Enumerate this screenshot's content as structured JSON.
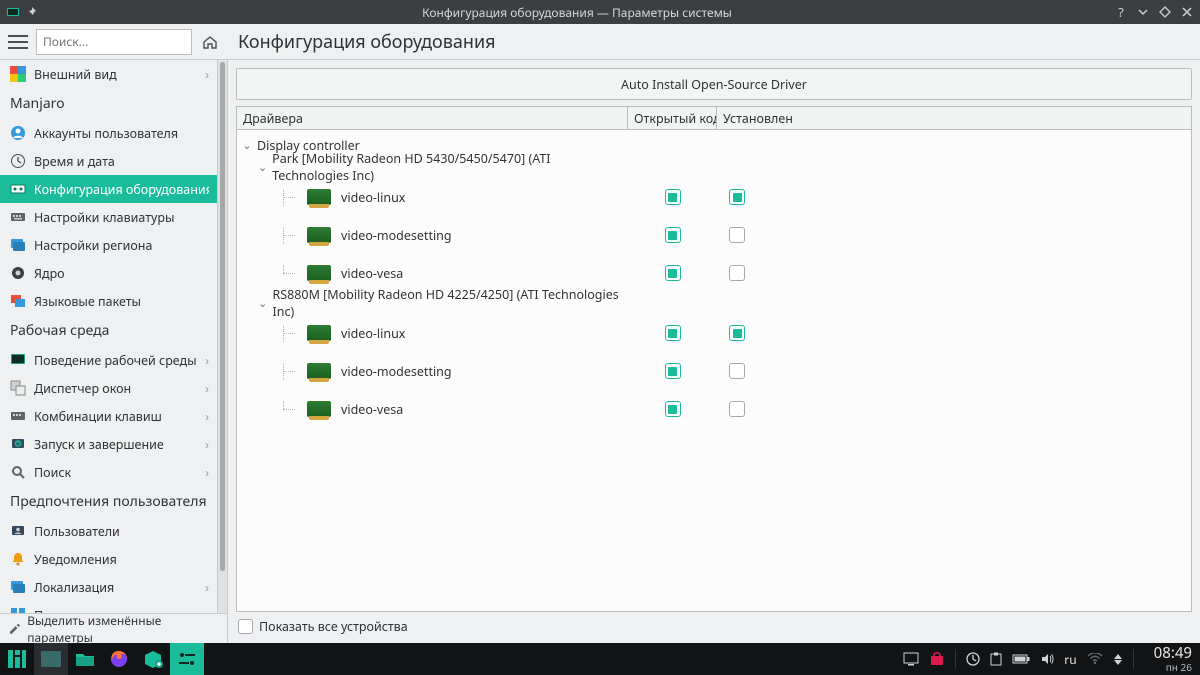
{
  "window": {
    "title": "Конфигурация оборудования — Параметры системы"
  },
  "toolbar": {
    "search_placeholder": "Поиск...",
    "page_title": "Конфигурация оборудования"
  },
  "sidebar": {
    "groups": [
      {
        "head": null,
        "items": [
          {
            "icon": "appearance",
            "label": "Внешний вид",
            "chev": true
          }
        ]
      },
      {
        "head": "Manjaro",
        "items": [
          {
            "icon": "accounts",
            "label": "Аккаунты пользователя"
          },
          {
            "icon": "clock",
            "label": "Время и дата"
          },
          {
            "icon": "hardware",
            "label": "Конфигурация оборудования",
            "active": true
          },
          {
            "icon": "keyboard",
            "label": "Настройки клавиатуры"
          },
          {
            "icon": "locale",
            "label": "Настройки региона"
          },
          {
            "icon": "kernel",
            "label": "Ядро"
          },
          {
            "icon": "lang",
            "label": "Языковые пакеты"
          }
        ]
      },
      {
        "head": "Рабочая среда",
        "items": [
          {
            "icon": "desktop-behavior",
            "label": "Поведение рабочей среды",
            "chev": true
          },
          {
            "icon": "wm",
            "label": "Диспетчер окон",
            "chev": true
          },
          {
            "icon": "shortcuts",
            "label": "Комбинации клавиш",
            "chev": true
          },
          {
            "icon": "startup",
            "label": "Запуск и завершение",
            "chev": true
          },
          {
            "icon": "search",
            "label": "Поиск",
            "chev": true
          }
        ]
      },
      {
        "head": "Предпочтения пользователя",
        "items": [
          {
            "icon": "users",
            "label": "Пользователи"
          },
          {
            "icon": "notify",
            "label": "Уведомления"
          },
          {
            "icon": "locale2",
            "label": "Локализация",
            "chev": true
          },
          {
            "icon": "apps",
            "label": "Приложения",
            "chev": true
          }
        ]
      }
    ],
    "footer": "Выделить изменённые параметры"
  },
  "main": {
    "auto_button": "Auto Install Open-Source Driver",
    "columns": {
      "c1": "Драйвера",
      "c2": "Открытый код",
      "c3": "Установлен"
    },
    "tree_root": "Display controller",
    "devices": [
      {
        "name": "Park [Mobility Radeon HD 5430/5450/5470] (ATI Technologies Inc)",
        "drivers": [
          {
            "name": "video-linux",
            "open": true,
            "installed": true
          },
          {
            "name": "video-modesetting",
            "open": true,
            "installed": false
          },
          {
            "name": "video-vesa",
            "open": true,
            "installed": false
          }
        ]
      },
      {
        "name": "RS880M [Mobility Radeon HD 4225/4250] (ATI Technologies Inc)",
        "drivers": [
          {
            "name": "video-linux",
            "open": true,
            "installed": true
          },
          {
            "name": "video-modesetting",
            "open": true,
            "installed": false
          },
          {
            "name": "video-vesa",
            "open": true,
            "installed": false
          }
        ]
      }
    ],
    "show_all": "Показать все устройства"
  },
  "panel": {
    "layout": "ru",
    "time": "08:49",
    "date": "пн 26"
  }
}
